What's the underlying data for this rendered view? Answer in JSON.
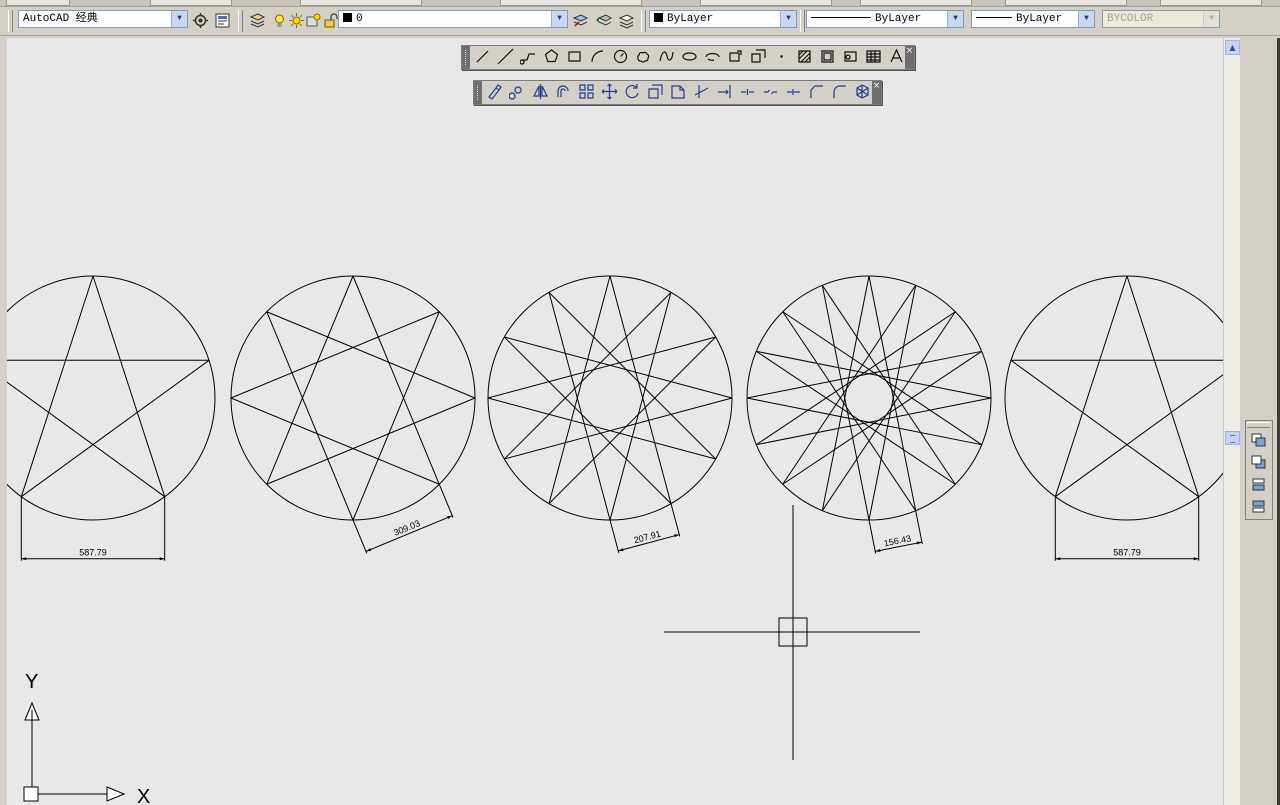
{
  "app": {
    "title": "AutoCAD"
  },
  "toolbar": {
    "workspace": {
      "value": "AutoCAD 经典"
    },
    "layer": {
      "value": "0"
    },
    "color": {
      "value": "ByLayer"
    },
    "linetype": {
      "value": "ByLayer"
    },
    "lineweight": {
      "value": "ByLayer"
    },
    "plotstyle": {
      "value": "BYCOLOR",
      "disabled": true
    }
  },
  "draw_toolbar": {
    "icons": [
      "line-icon",
      "construction-line-icon",
      "polyline-icon",
      "polygon-icon",
      "rectangle-icon",
      "arc-icon",
      "circle-icon",
      "revision-cloud-icon",
      "spline-icon",
      "ellipse-icon",
      "ellipse-arc-icon",
      "insert-block-icon",
      "make-block-icon",
      "point-icon",
      "hatch-icon",
      "gradient-icon",
      "region-icon",
      "table-icon",
      "multiline-text-icon"
    ]
  },
  "modify_toolbar": {
    "icons": [
      "erase-icon",
      "copy-icon",
      "mirror-icon",
      "offset-icon",
      "array-icon",
      "move-icon",
      "rotate-icon",
      "scale-icon",
      "stretch-icon",
      "trim-icon",
      "extend-icon",
      "break-at-point-icon",
      "break-icon",
      "join-icon",
      "chamfer-icon",
      "fillet-icon",
      "explode-icon"
    ]
  },
  "drawing": {
    "stars": [
      {
        "points": 5,
        "step": 2,
        "dimension": "587.79"
      },
      {
        "points": 8,
        "step": 3,
        "dimension": "309.03"
      },
      {
        "points": 12,
        "step": 5,
        "dimension": "207.91"
      },
      {
        "points": 16,
        "step": 7,
        "dimension": "156.43"
      },
      {
        "points": 5,
        "step": 2,
        "dimension": "587.79"
      }
    ]
  },
  "ucs": {
    "x_label": "X",
    "y_label": "Y"
  },
  "colors": {
    "canvas": "#e8e8e8",
    "ink": "#000000",
    "chrome": "#d4d0c8"
  }
}
